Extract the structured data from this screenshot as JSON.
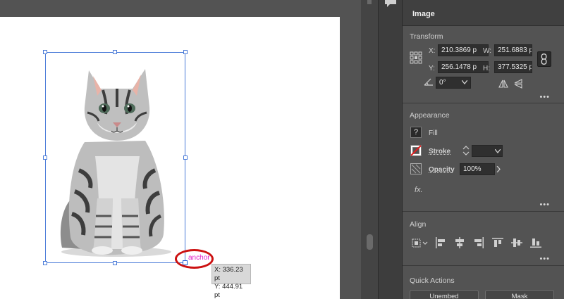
{
  "canvas": {
    "anchor_label": "anchor",
    "tooltip_x": "X: 336.23 pt",
    "tooltip_y": "Y: 444.91 pt"
  },
  "panel": {
    "header_label": "Image",
    "transform": {
      "title": "Transform",
      "x_label": "X:",
      "x_value": "210.3869 p",
      "y_label": "Y:",
      "y_value": "256.1478 p",
      "w_label": "W:",
      "w_value": "251.6883 p",
      "h_label": "H:",
      "h_value": "377.5325 p",
      "angle_value": "0°"
    },
    "appearance": {
      "title": "Appearance",
      "fill_label": "Fill",
      "fill_swatch": "?",
      "stroke_label": "Stroke",
      "opacity_label": "Opacity",
      "opacity_value": "100%",
      "fx_label": "fx."
    },
    "align": {
      "title": "Align"
    },
    "quick_actions": {
      "title": "Quick Actions",
      "embed_label": "Unembed",
      "mask_label": "Mask"
    },
    "more": "•••"
  },
  "colors": {
    "selection_blue": "#4a7bd8",
    "anchor_magenta": "#e11ec8",
    "annotation_red": "#cc1111"
  }
}
